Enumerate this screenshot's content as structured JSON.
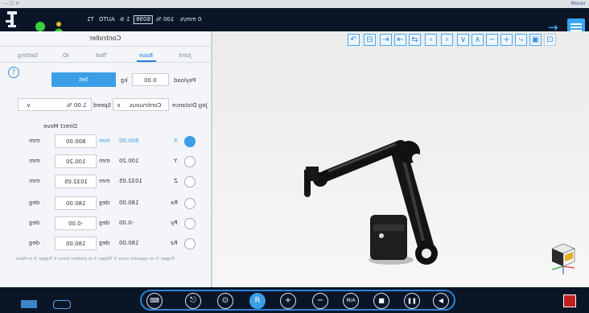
{
  "titlebar": {
    "left": "— ☐ ✕",
    "right": "Mover"
  },
  "status": {
    "speed": "0 mm/s",
    "pct": "100 %",
    "code": "6098",
    "tool_no": "1",
    "mode": "AUTO",
    "tool_prefix": "T1",
    "speed_icon": "speed-gauge-icon"
  },
  "panel": {
    "title": "Controller",
    "tabs": [
      "Joint",
      "Base",
      "Tool",
      "IO",
      "Setting"
    ],
    "payload_label": "Payload",
    "payload_value": "0.00",
    "payload_unit": "kg",
    "set_label": "Set",
    "jog_label": "Jog Distance",
    "jog_value": "Continuous",
    "speed_label": "Speed",
    "speed_value": "1.00 %",
    "direct_move": "Direct Move",
    "rows": [
      {
        "axis": "X",
        "current": "800.00",
        "unit": "mm",
        "target": "800.00",
        "tunit": "mm",
        "selected": true
      },
      {
        "axis": "Y",
        "current": "100.20",
        "unit": "mm",
        "target": "100.20",
        "tunit": "mm",
        "selected": false
      },
      {
        "axis": "Z",
        "current": "1032.05",
        "unit": "mm",
        "target": "1032.05",
        "tunit": "mm",
        "selected": false
      },
      {
        "axis": "Rx",
        "current": "180.00",
        "unit": "deg",
        "target": "180.00",
        "tunit": "deg",
        "selected": false
      },
      {
        "axis": "Ry",
        "current": "-0.00",
        "unit": "deg",
        "target": "-0.00",
        "tunit": "deg",
        "selected": false
      },
      {
        "axis": "Rz",
        "current": "180.00",
        "unit": "deg",
        "target": "180.00",
        "tunit": "deg",
        "selected": false
      }
    ],
    "footnote": "Trigger ① no opposite move ② Trigger ③ to position move ④ Trigger ⑤ to Move"
  },
  "viewport": {
    "toolbar": [
      "↶",
      "⊟",
      "⇥",
      "⇤",
      "⇆",
      "‹",
      "›",
      "∨",
      "∧",
      "−",
      "+",
      "⤷",
      "▣",
      "⊡"
    ]
  },
  "bottom": {
    "buttons": [
      "⌨",
      "⎋",
      "⊙",
      "R",
      "+",
      "−",
      "M/A",
      "■",
      "❚❚",
      "◀"
    ],
    "active_index": 3
  },
  "colors": {
    "accent": "#3b9ee6",
    "bar": "#0a1628",
    "stop": "#c21f1f"
  }
}
